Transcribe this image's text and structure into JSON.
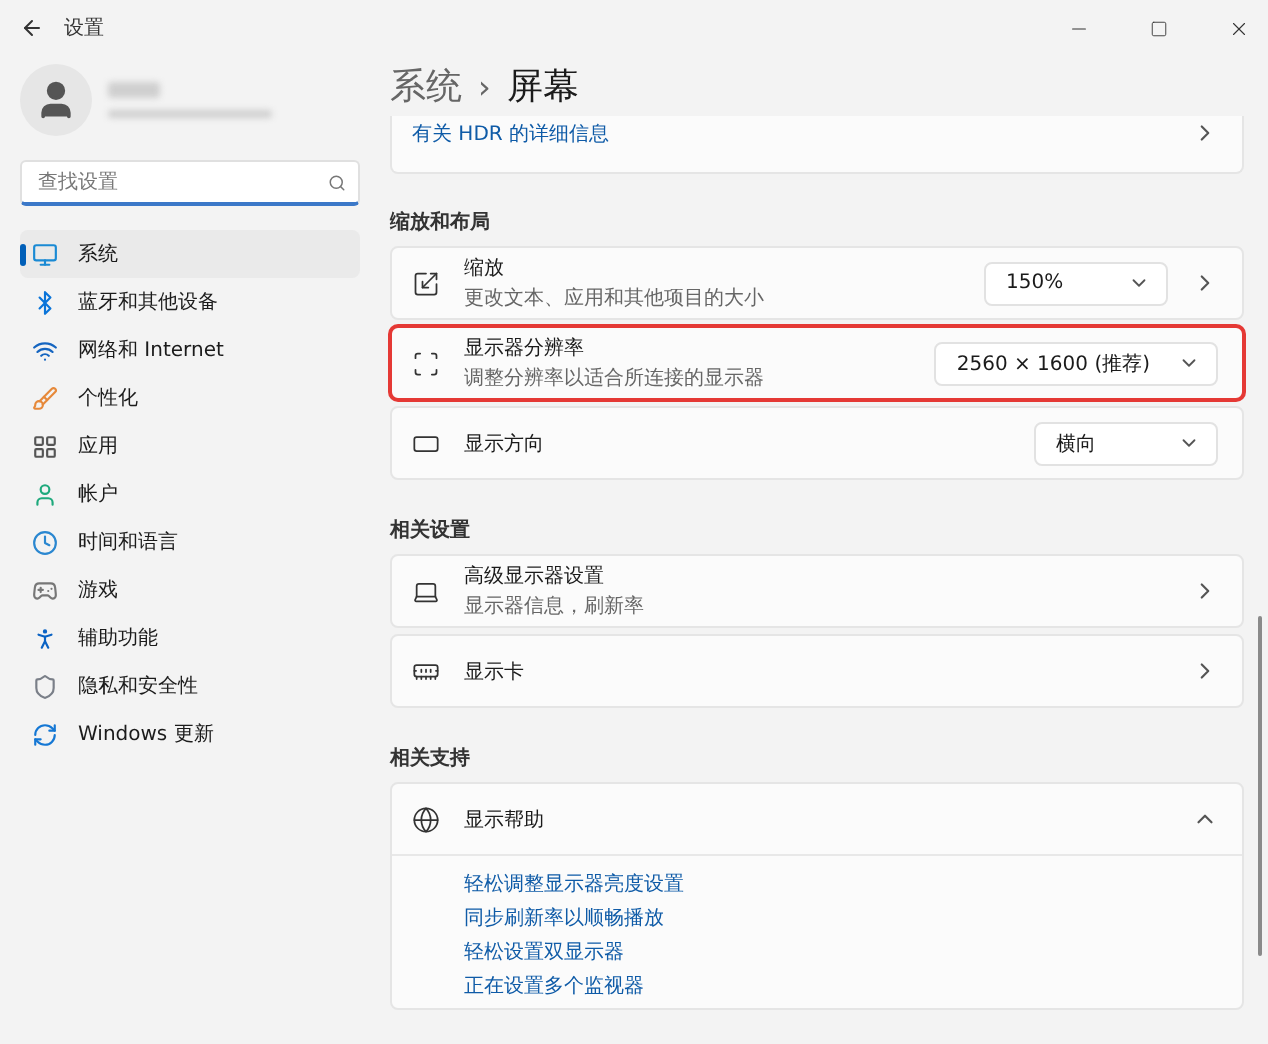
{
  "window": {
    "title": "设置"
  },
  "search": {
    "placeholder": "查找设置"
  },
  "nav": [
    {
      "label": "系统",
      "selected": true
    },
    {
      "label": "蓝牙和其他设备",
      "selected": false
    },
    {
      "label": "网络和 Internet",
      "selected": false
    },
    {
      "label": "个性化",
      "selected": false
    },
    {
      "label": "应用",
      "selected": false
    },
    {
      "label": "帐户",
      "selected": false
    },
    {
      "label": "时间和语言",
      "selected": false
    },
    {
      "label": "游戏",
      "selected": false
    },
    {
      "label": "辅助功能",
      "selected": false
    },
    {
      "label": "隐私和安全性",
      "selected": false
    },
    {
      "label": "Windows 更新",
      "selected": false
    }
  ],
  "breadcrumb": {
    "parent": "系统",
    "separator": "›",
    "current": "屏幕"
  },
  "hdr_card": {
    "link": "有关 HDR 的详细信息"
  },
  "sections": [
    {
      "heading": "缩放和布局",
      "cards": [
        {
          "kind": "dropdown",
          "title": "缩放",
          "subtitle": "更改文本、应用和其他项目的大小",
          "value": "150%",
          "chevron": true,
          "highlighted": false
        },
        {
          "kind": "dropdown",
          "title": "显示器分辨率",
          "subtitle": "调整分辨率以适合所连接的显示器",
          "value": "2560 × 1600 (推荐)",
          "chevron": false,
          "highlighted": true
        },
        {
          "kind": "dropdown",
          "title": "显示方向",
          "value": "横向",
          "chevron": false,
          "highlighted": false
        }
      ]
    },
    {
      "heading": "相关设置",
      "cards": [
        {
          "kind": "link",
          "title": "高级显示器设置",
          "subtitle": "显示器信息，刷新率",
          "highlighted": false
        },
        {
          "kind": "link",
          "title": "显示卡",
          "highlighted": false
        }
      ]
    },
    {
      "heading": "相关支持",
      "cards": [
        {
          "kind": "expander",
          "title": "显示帮助",
          "expanded": true,
          "highlighted": false,
          "links": [
            "轻松调整显示器亮度设置",
            "同步刷新率以顺畅播放",
            "轻松设置双显示器",
            "正在设置多个监视器"
          ]
        }
      ]
    }
  ]
}
